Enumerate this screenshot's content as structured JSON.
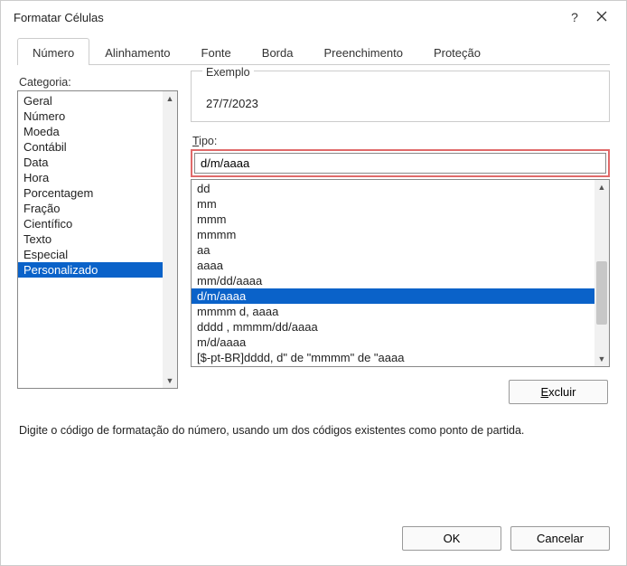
{
  "title": "Formatar Células",
  "tabs": [
    "Número",
    "Alinhamento",
    "Fonte",
    "Borda",
    "Preenchimento",
    "Proteção"
  ],
  "activeTab": 0,
  "categoryLabel": "Categoria:",
  "categories": [
    "Geral",
    "Número",
    "Moeda",
    "Contábil",
    "Data",
    "Hora",
    "Porcentagem",
    "Fração",
    "Científico",
    "Texto",
    "Especial",
    "Personalizado"
  ],
  "selectedCategory": 11,
  "exampleLabel": "Exemplo",
  "exampleValue": "27/7/2023",
  "tipoLabel": "Tipo:",
  "tipoValue": "d/m/aaaa",
  "formats": [
    "dd",
    "mm",
    "mmm",
    "mmmm",
    "aa",
    "aaaa",
    "mm/dd/aaaa",
    "d/m/aaaa",
    "mmmm d, aaaa",
    "dddd , mmmm/dd/aaaa",
    "m/d/aaaa",
    "[$-pt-BR]dddd, d\" de \"mmmm\" de \"aaaa"
  ],
  "selectedFormat": 7,
  "deleteBtn": "Excluir",
  "instruction": "Digite o código de formatação do número, usando um dos códigos existentes como ponto de partida.",
  "okBtn": "OK",
  "cancelBtn": "Cancelar"
}
